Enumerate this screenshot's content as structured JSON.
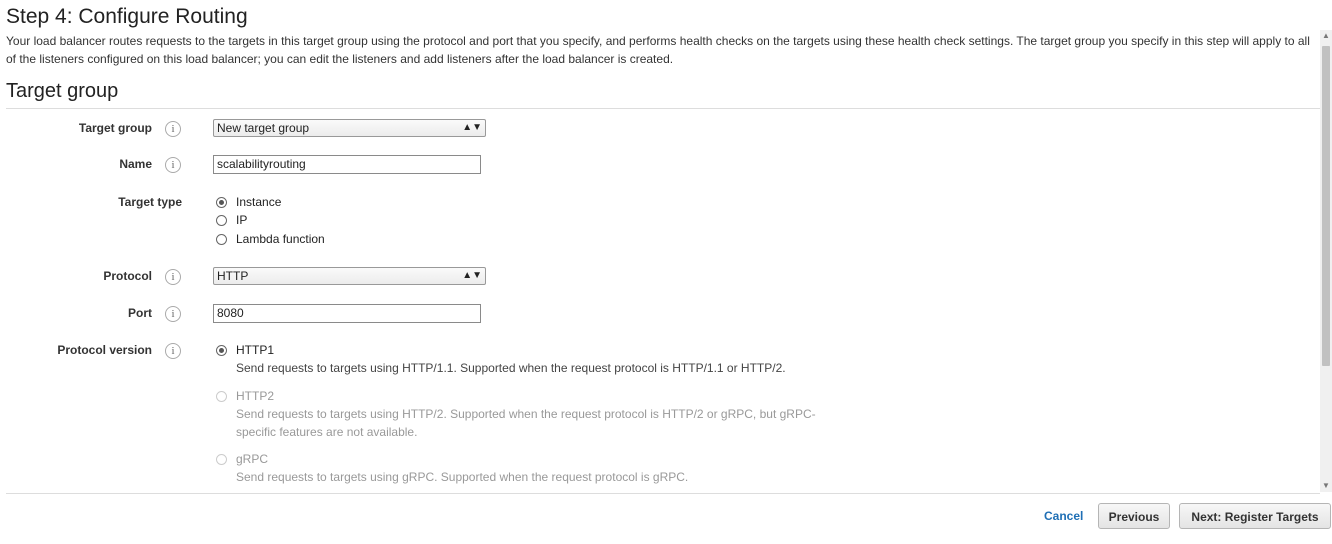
{
  "page": {
    "title": "Step 4: Configure Routing",
    "intro": "Your load balancer routes requests to the targets in this target group using the protocol and port that you specify, and performs health checks on the targets using these health check settings. The target group you specify in this step will apply to all of the listeners configured on this load balancer; you can edit the listeners and add listeners after the load balancer is created."
  },
  "section": {
    "title": "Target group"
  },
  "form": {
    "target_group": {
      "label": "Target group",
      "value": "New target group"
    },
    "name": {
      "label": "Name",
      "value": "scalabilityrouting"
    },
    "target_type": {
      "label": "Target type",
      "options": [
        "Instance",
        "IP",
        "Lambda function"
      ],
      "selected": "Instance"
    },
    "protocol": {
      "label": "Protocol",
      "value": "HTTP"
    },
    "port": {
      "label": "Port",
      "value": "8080"
    },
    "protocol_version": {
      "label": "Protocol version",
      "selected": "HTTP1",
      "options": [
        {
          "label": "HTTP1",
          "desc": "Send requests to targets using HTTP/1.1. Supported when the request protocol is HTTP/1.1 or HTTP/2.",
          "disabled": false
        },
        {
          "label": "HTTP2",
          "desc": "Send requests to targets using HTTP/2. Supported when the request protocol is HTTP/2 or gRPC, but gRPC-specific features are not available.",
          "disabled": true
        },
        {
          "label": "gRPC",
          "desc": "Send requests to targets using gRPC. Supported when the request protocol is gRPC.",
          "disabled": true
        }
      ]
    }
  },
  "footer": {
    "cancel": "Cancel",
    "previous": "Previous",
    "next": "Next: Register Targets"
  },
  "icons": {
    "info": "info-icon",
    "dropdown": "dropdown-arrow-icon"
  },
  "colors": {
    "link": "#1f6fb5",
    "disabled_text": "#999999"
  }
}
